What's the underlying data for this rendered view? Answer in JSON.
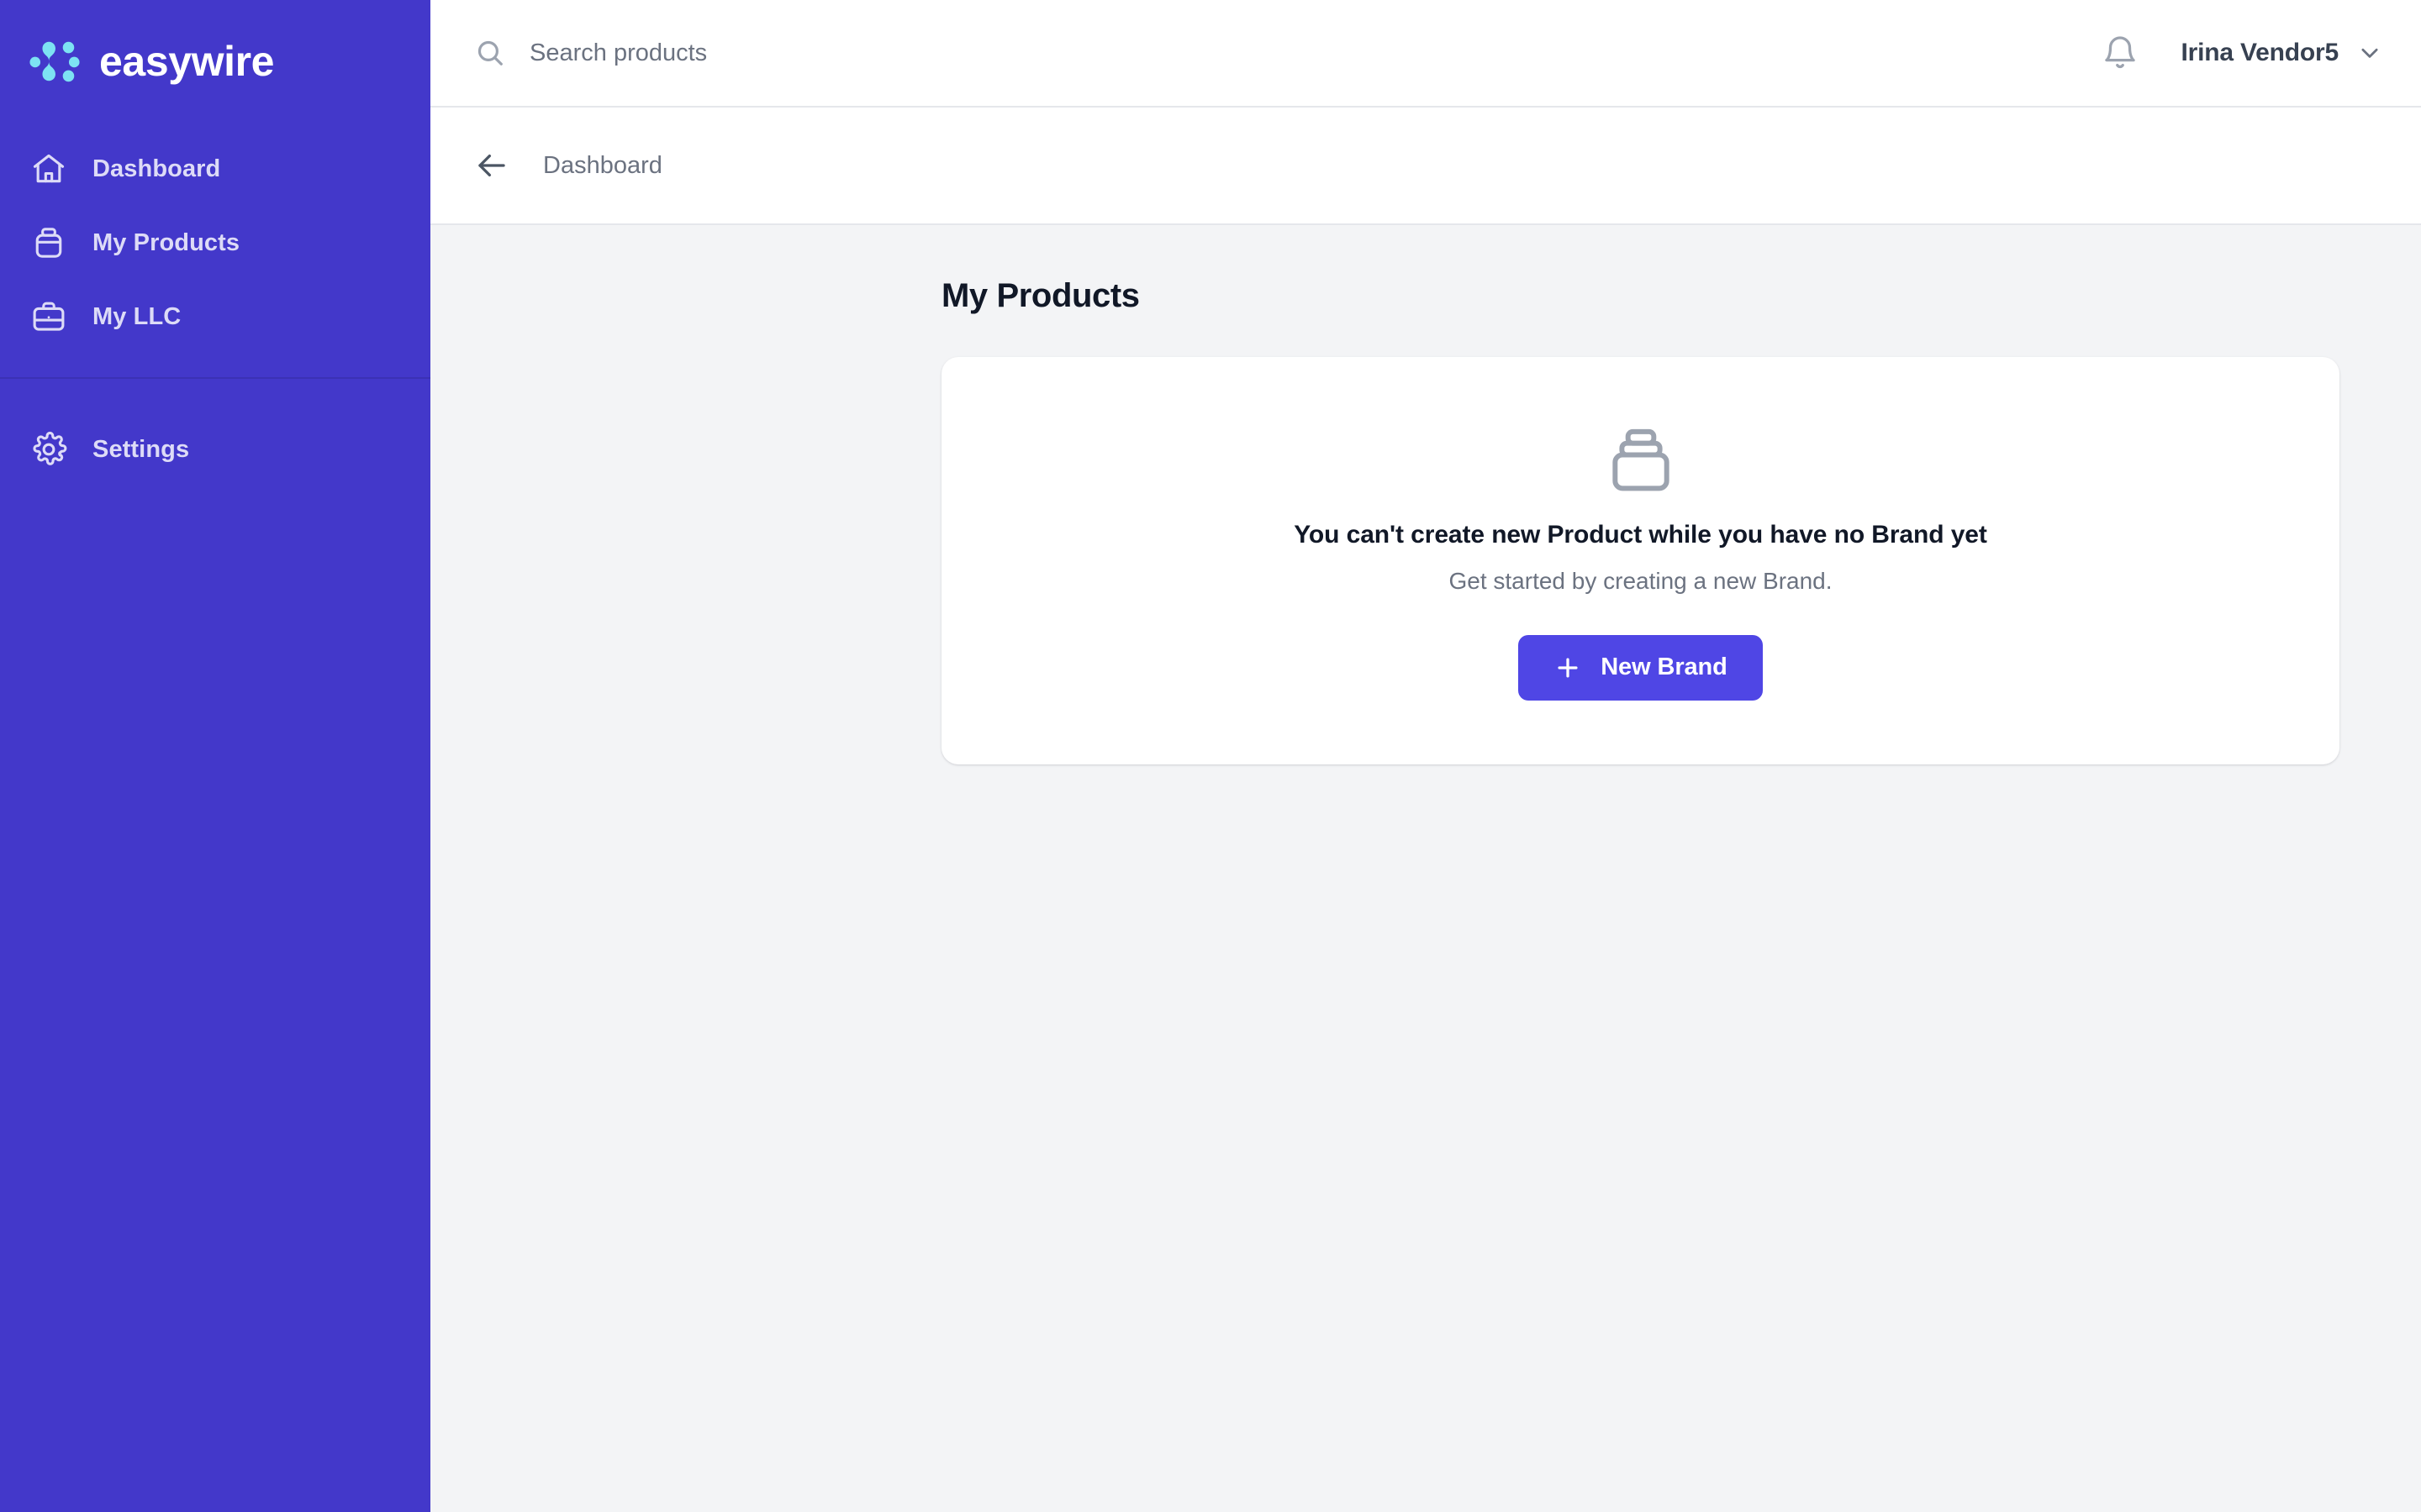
{
  "brand": {
    "name": "easywire",
    "logo_icon": "easywire-node-logo",
    "logo_color": "#7DE2F3",
    "sidebar_color": "#4338CA"
  },
  "sidebar": {
    "primary_items": [
      {
        "label": "Dashboard",
        "icon": "home-icon"
      },
      {
        "label": "My Products",
        "icon": "archive-box-icon"
      },
      {
        "label": "My LLC",
        "icon": "briefcase-icon"
      }
    ],
    "secondary_items": [
      {
        "label": "Settings",
        "icon": "gear-icon"
      }
    ]
  },
  "topbar": {
    "search": {
      "placeholder": "Search products",
      "value": "",
      "icon": "search-icon"
    },
    "notifications_icon": "bell-icon",
    "user": {
      "name": "Irina Vendor5",
      "chevron_icon": "chevron-down-icon"
    }
  },
  "breadcrumb": {
    "back_icon": "arrow-left-icon",
    "label": "Dashboard"
  },
  "main": {
    "page_title": "My Products",
    "empty_state": {
      "icon": "stacked-boxes-icon",
      "title": "You can't create new Product while you have no Brand yet",
      "subtitle": "Get started by creating a new Brand.",
      "action_label": "New Brand",
      "action_icon": "plus-icon",
      "action_color": "#4F46E5"
    }
  }
}
